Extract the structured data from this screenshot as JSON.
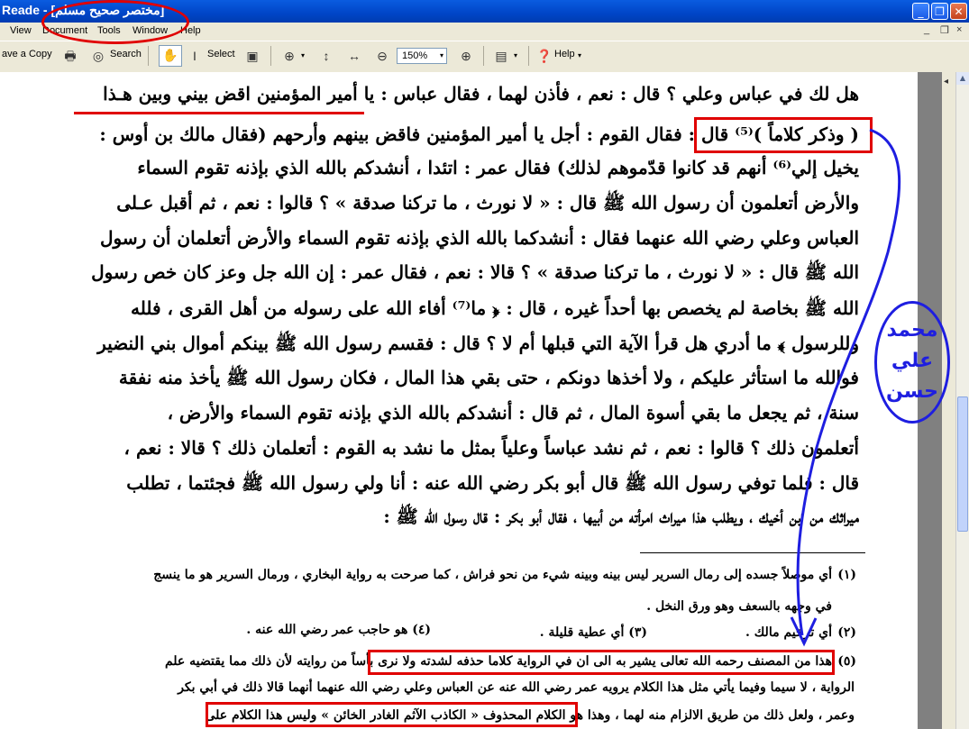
{
  "window": {
    "title": "Reade - [مختصر صحيح مسلم]",
    "min_glyph": "_",
    "max_glyph": "❐",
    "close_glyph": "✕",
    "mdi_min": "_",
    "mdi_restore": "❐",
    "mdi_close": "×"
  },
  "menu": [
    "View",
    "Document",
    "Tools",
    "Window",
    "Help"
  ],
  "toolbar": {
    "save_copy": "ave a Copy",
    "search": "Search",
    "select": "Select",
    "zoom_value": "150%",
    "help": "Help",
    "dropdown_glyph": "▾"
  },
  "page": {
    "main_lines": [
      "هل لك في عباس وعلي ؟ قال : نعم ، فأذن لهما ، فقال عباس : يا أمير المؤمنين اقض بيني وبين هـذا",
      "( وذكر كلاماً )⁽⁵⁾ قال : فقال القوم : أجل يا أمير المؤمنين فاقض بينهم وأرحهم (فقال مالك بن أوس :",
      "يخيل إلي⁽⁶⁾ أنهم قد كانوا قدّموهم لذلك) فقال عمر : اتئدا ، أنشدكم بالله الذي بإذنه تقوم السماء",
      "والأرض أتعلمون أن رسول الله ﷺ قال : « لا نورث ، ما تركنا صدقة » ؟ قالوا : نعم ، ثم أقبل عـلى",
      "العباس وعلي رضي الله عنهما فقال : أنشدكما بالله الذي بإذنه تقوم السماء والأرض أتعلمان أن رسول",
      "الله ﷺ قال : « لا نورث ، ما تركنا صدقة » ؟ قالا : نعم ، فقال عمر : إن الله جل وعز كان خص رسول",
      "الله ﷺ بخاصة لم يخصص بها أحداً غيره ، قال : ﴿ ما⁽⁷⁾ أفاء الله على رسوله من أهل القرى ، فلله",
      "وللرسول ﴾ ما أدري هل قرأ الآية التي قبلها أم لا ؟ قال : فقسم رسول الله ﷺ بينكم أموال بني النضير",
      "فوالله ما استأثر عليكم ، ولا أخذها دونكم ، حتى بقي هذا المال ، فكان رسول الله ﷺ يأخذ منه نفقة",
      "سنة ، ثم يجعل ما بقي أسوة المال ، ثم قال : أنشدكم بالله الذي بإذنه تقوم السماء والأرض ،",
      "أتعلمون ذلك ؟ قالوا : نعم ، ثم نشد عباساً وعلياً بمثل ما نشد به القوم : أتعلمان ذلك ؟ قالا : نعم ،",
      "قال : فلما توفي رسول الله ﷺ قال أبو بكر رضي الله عنه : أنا ولي رسول الله ﷺ فجئتما ، تطلب",
      "ميراثك من ابن أخيك ، ويطلب هذا ميراث امرأته من أبيها ، فقال أبو بكر : قال رسول الله ﷺ :"
    ],
    "fn1_num": "(١)",
    "fn1_line1": "أي موصلاً جسده إلى رمال السرير ليس بينه وبينه شيء من نحو فراش ، كما صرحت به رواية البخاري ، ورمال السرير هو ما ينسج",
    "fn1_line2": "في وجهه بالسعف وهو ورق النخل .",
    "fn2_num": "(٢)",
    "fn2_text": "أي ترخيم مالك .",
    "fn3_text": "(٣) أي عطية قليلة .",
    "fn4_text": "(٤) هو حاجب عمر رضي الله عنه .",
    "fn5_num": "(٥)",
    "fn5_line1": "هذا من المصنف رحمه الله تعالى يشير به الى ان في الرواية كلاما حذفه لشدته ولا نرى بأساً من روايته لأن ذلك مما يقتضيه علم",
    "fn5_line2": "الرواية ، لا سيما وفيما يأتي مثل هذا الكلام يرويه عمر رضي الله عنه عن العباس وعلي رضي الله عنهما أنهما قالا ذلك في أبي بكر",
    "fn5_line3": "وعمر ، ولعل ذلك من طريق الالزام منه لهما ، وهذا هو الكلام المحذوف « الكاذب الآثم الغادر الخائن » وليس هذا الكلام على"
  },
  "annotation": {
    "author_name": "محمد\nعلي\nحسن",
    "name_line1": "محمد",
    "name_line2": "علي",
    "name_line3": "حسن",
    "pen_color": "#1e1ee0",
    "mark_color": "#e00000"
  }
}
